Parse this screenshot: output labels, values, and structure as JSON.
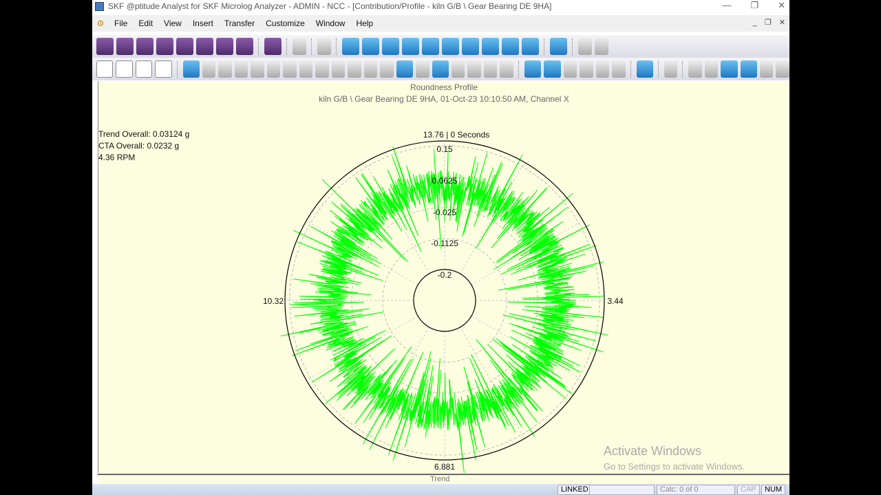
{
  "window": {
    "title": "SKF @ptitude Analyst for SKF Microlog Analyzer - ADMIN - NCC - [Contribution/Profile - kiln G/B \\ Gear Bearing DE  9HA]"
  },
  "menu": [
    "File",
    "Edit",
    "View",
    "Insert",
    "Transfer",
    "Customize",
    "Window",
    "Help"
  ],
  "plot": {
    "title": "Roundness Profile",
    "subtitle": "kiln G/B \\ Gear Bearing DE  9HA, 01-Oct-23 10:10:50 AM, Channel X",
    "trend_overall": "Trend Overall: 0.03124 g",
    "cta_overall": "CTA Overall: 0.0232 g",
    "rpm": "4.36 RPM",
    "top_label": "13.76 | 0 Seconds",
    "right_label": "3.44",
    "bottom_label": "6.881",
    "left_label": "10.32",
    "ring_labels": [
      "0.15",
      "0.0625",
      "-0.025",
      "-0.1125",
      "-0.2"
    ],
    "trace_color": "#00ff00"
  },
  "trend_tab": "Trend",
  "watermark": {
    "line1": "Activate Windows",
    "line2": "Go to Settings to activate Windows."
  },
  "status": {
    "linked": "LINKED",
    "calc": "Calc: 0 of 0",
    "cap": "CAP",
    "num": "NUM"
  }
}
